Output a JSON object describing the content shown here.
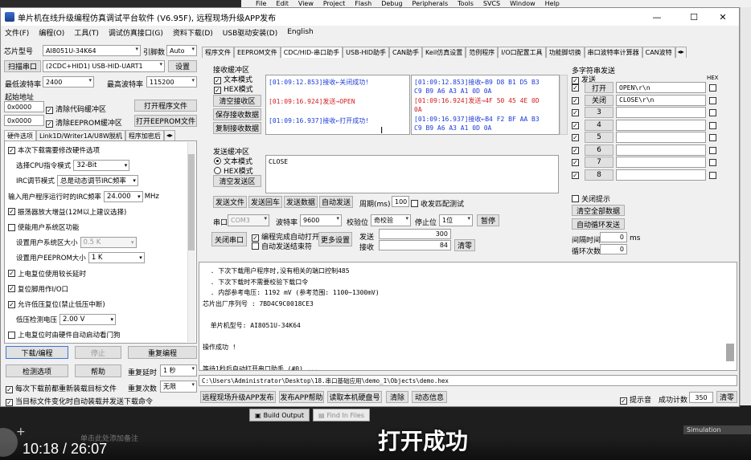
{
  "ide": {
    "menu": [
      "File",
      "Edit",
      "View",
      "Project",
      "Flash",
      "Debug",
      "Peripherals",
      "Tools",
      "SVCS",
      "Window",
      "Help"
    ],
    "tabs": [
      "Build Output",
      "Find In Files"
    ],
    "simulation": "Simulation",
    "hint": "单击此处添加备注"
  },
  "window": {
    "title": "单片机在线升级编程仿真调试平台软件 (V6.95F), 远程现场升级APP发布",
    "controls": {
      "minimize": "—",
      "maximize": "☐",
      "close": "✕"
    },
    "menu": [
      "文件(F)",
      "编程(O)",
      "工具(T)",
      "调试仿真接口(G)",
      "资料下载(D)",
      "USB驱动安装(D)",
      "English"
    ]
  },
  "left": {
    "chip_label": "芯片型号",
    "chip_value": "AI8051U-34K64",
    "pin_label": "引脚数",
    "pin_value": "Auto",
    "scan_btn": "扫描串口",
    "port_value": "(2CDC+HID1) USB-HID-UART1",
    "settings_btn": "设置",
    "min_baud_label": "最低波特率",
    "min_baud": "2400",
    "max_baud_label": "最高波特率",
    "max_baud": "115200",
    "start_addr_label": "起始地址",
    "addr1": "0x0000",
    "clear_code": "清除代码缓冲区",
    "open_prog_btn": "打开程序文件",
    "addr2": "0x0000",
    "clear_eeprom": "清除EEPROM缓冲区",
    "open_eeprom_btn": "打开EEPROM文件",
    "tabs": [
      "硬件选项",
      "Link1D/Writer1A/U8W脱机",
      "程序加密后"
    ],
    "options": [
      {
        "checked": true,
        "text": "本次下载需要修改硬件选项"
      },
      {
        "label": "选择CPU指令模式",
        "value": "32-Bit"
      },
      {
        "label": "IRC调节模式",
        "value": "总是动态调节IRC频率"
      },
      {
        "label": "输入用户程序运行时的IRC频率",
        "value": "24.000",
        "unit": "MHz"
      },
      {
        "checked": true,
        "text": "振荡器放大增益(12M以上建议选择)"
      },
      {
        "checked": false,
        "text": "使能用户系统区功能"
      },
      {
        "label": "设置用户系统区大小",
        "value": "0.5 K"
      },
      {
        "label": "设置用户EEPROM大小",
        "value": "1 K"
      },
      {
        "checked": true,
        "text": "上电复位使用较长延时"
      },
      {
        "checked": true,
        "text": "复位脚用作I/O口"
      },
      {
        "checked": true,
        "text": "允许低压复位(禁止低压中断)"
      },
      {
        "label": "低压检测电压",
        "value": "2.00 V"
      },
      {
        "checked": false,
        "text": "上电复位时由硬件自动启动看门狗"
      }
    ],
    "download_btn": "下载/编程",
    "stop_btn": "停止",
    "reprogram_btn": "重复编程",
    "check_btn": "检测选项",
    "help_btn": "帮助",
    "repeat_delay_label": "重复延时",
    "repeat_delay": "1 秒",
    "reload_check": "每次下载前都重新装载目标文件",
    "repeat_count_label": "重复次数",
    "repeat_count": "无限",
    "autosend_check": "当目标文件变化时自动装载并发送下载命令"
  },
  "right": {
    "tabs": [
      "程序文件",
      "EEPROM文件",
      "CDC/HID-串口助手",
      "USB-HID助手",
      "CAN助手",
      "Keil仿真设置",
      "范例程序",
      "I/O口配置工具",
      "功能脚切换",
      "串口波特率计算器",
      "CAN波特"
    ],
    "recv_title": "接收缓冲区",
    "recv_text_mode": "文本模式",
    "recv_hex_mode": "HEX模式",
    "clear_recv": "清空接收区",
    "save_recv": "保存接收数据",
    "copy_recv": "复制接收数据",
    "recv_text_lines": [
      {
        "cls": "blue",
        "text": "[01:09:12.853]接收←关闭成功!"
      },
      {
        "cls": "red",
        "text": "[01:09:16.924]发送→OPEN"
      },
      {
        "cls": "blue",
        "text": "[01:09:16.937]接收←打开成功!"
      }
    ],
    "recv_hex_lines": [
      {
        "cls": "blue",
        "text": "[01:09:12.853]接收←B9 D8 B1 D5 B3"
      },
      {
        "cls": "blue",
        "text": "C9 B9 A6 A3 A1 0D 0A"
      },
      {
        "cls": "red",
        "text": "[01:09:16.924]发送→4F 50 45 4E 0D"
      },
      {
        "cls": "red",
        "text": "0A"
      },
      {
        "cls": "blue",
        "text": "[01:09:16.937]接收←B4 F2 BF AA B3"
      },
      {
        "cls": "blue",
        "text": "C9 B9 A6 A3 A1 0D 0A"
      }
    ],
    "send_title": "发送缓冲区",
    "send_text_mode": "文本模式",
    "send_hex_mode": "HEX模式",
    "clear_send": "清空发送区",
    "send_content": "CLOSE",
    "send_file_btn": "发送文件",
    "send_return_btn": "发送回车",
    "send_data_btn": "发送数据",
    "auto_send_btn": "自动发送",
    "period_label": "周期(ms)",
    "period_value": "100",
    "recv_match": "收发匹配测试",
    "port_label": "串口",
    "port_value": "COM3",
    "baud_label": "波特率",
    "baud_value": "9600",
    "parity_label": "校验位",
    "parity_value": "奇校验",
    "stop_label": "停止位",
    "stop_value": "1位",
    "pause_btn": "暂停",
    "close_port_btn": "关闭串口",
    "auto_open": "编程完成自动打开",
    "auto_send_end": "自动发送结束符",
    "more_btn": "更多设置",
    "send_count_label": "发送",
    "send_count": "300",
    "recv_count_label": "接收",
    "recv_count": "84",
    "clear_count_btn": "清零",
    "multi_title": "多字符串发送",
    "multi_send_label": "发送",
    "multi_hex_label": "HEX",
    "multi_rows": [
      {
        "checked": true,
        "btn": "打开",
        "value": "OPEN\\r\\n"
      },
      {
        "checked": true,
        "btn": "关闭",
        "value": "CLOSE\\r\\n"
      },
      {
        "checked": true,
        "btn": "3",
        "value": ""
      },
      {
        "checked": true,
        "btn": "4",
        "value": ""
      },
      {
        "checked": true,
        "btn": "5",
        "value": ""
      },
      {
        "checked": true,
        "btn": "6",
        "value": ""
      },
      {
        "checked": true,
        "btn": "7",
        "value": ""
      },
      {
        "checked": true,
        "btn": "8",
        "value": ""
      }
    ],
    "close_hint": "关闭提示",
    "clear_all_btn": "清空全部数据",
    "auto_loop_btn": "自动循环发送",
    "interval_label": "间隔时间",
    "interval_value": "0",
    "interval_unit": "ms",
    "loop_count_label": "循环次数",
    "loop_count": "0"
  },
  "log": {
    "lines": [
      "  . 下次下载用户程序时,没有相关的端口控制485",
      "  . 下次下载时不需要校验下载口令",
      "  . 内部参考电压: 1192 mV (参考范围: 1100~1300mV)",
      "芯片出厂序列号 : 7BD4C9C0018CE3",
      "",
      "  单片机型号: AI8051U-34K64",
      "",
      "操作成功 !",
      "",
      "等待1秒后自动打开串口助手 (#0) ..."
    ],
    "path": "C:\\Users\\Administrator\\Desktop\\18.串口基础应用\\demo_1\\Objects\\demo.hex"
  },
  "bottom": {
    "publish_app": "远程现场升级APP发布",
    "publish_hex": "发布APP帮助",
    "read_hw": "读取本机硬盘号",
    "clear_btn": "清除",
    "activity": "动态信息",
    "beep_label": "提示音",
    "success_label": "成功计数",
    "success_count": "350",
    "clear2_btn": "清零"
  },
  "video": {
    "time": "10:18 / 26:07",
    "subtitle": "打开成功"
  }
}
